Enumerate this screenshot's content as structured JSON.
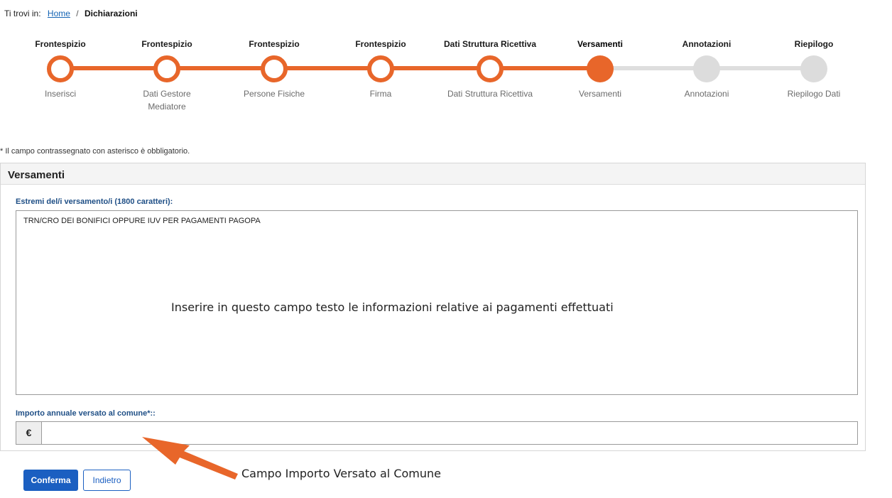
{
  "breadcrumb": {
    "prefix": "Ti trovi in:",
    "home": "Home",
    "separator": "/",
    "current": "Dichiarazioni"
  },
  "stepper": {
    "steps": [
      {
        "title": "Frontespizio",
        "subtitle": "Inserisci",
        "state": "done"
      },
      {
        "title": "Frontespizio",
        "subtitle": "Dati Gestore Mediatore",
        "state": "done"
      },
      {
        "title": "Frontespizio",
        "subtitle": "Persone Fisiche",
        "state": "done"
      },
      {
        "title": "Frontespizio",
        "subtitle": "Firma",
        "state": "done"
      },
      {
        "title": "Dati Struttura Ricettiva",
        "subtitle": "Dati Struttura Ricettiva",
        "state": "done"
      },
      {
        "title": "Versamenti",
        "subtitle": "Versamenti",
        "state": "current"
      },
      {
        "title": "Annotazioni",
        "subtitle": "Annotazioni",
        "state": "todo"
      },
      {
        "title": "Riepilogo",
        "subtitle": "Riepilogo Dati",
        "state": "todo"
      }
    ],
    "colors": {
      "done": "#e8662a",
      "todo": "#dcdcdc"
    }
  },
  "required_note": "* Il campo contrassegnato con asterisco è obbligatorio.",
  "panel": {
    "title": "Versamenti",
    "payments_field": {
      "label": "Estremi del/i versamento/i (1800 caratteri):",
      "value": "TRN/CRO DEI BONIFICI OPPURE IUV PER PAGAMENTI PAGOPA"
    },
    "amount_field": {
      "label": "Importo annuale versato al comune*::",
      "currency": "€",
      "value": ""
    }
  },
  "annotations": {
    "textarea_hint": "Inserire in questo campo testo le informazioni relative ai pagamenti effettuati",
    "arrow_label": "Campo Importo Versato al Comune",
    "arrow_color": "#e8662a"
  },
  "buttons": {
    "confirm": "Conferma",
    "back": "Indietro"
  }
}
